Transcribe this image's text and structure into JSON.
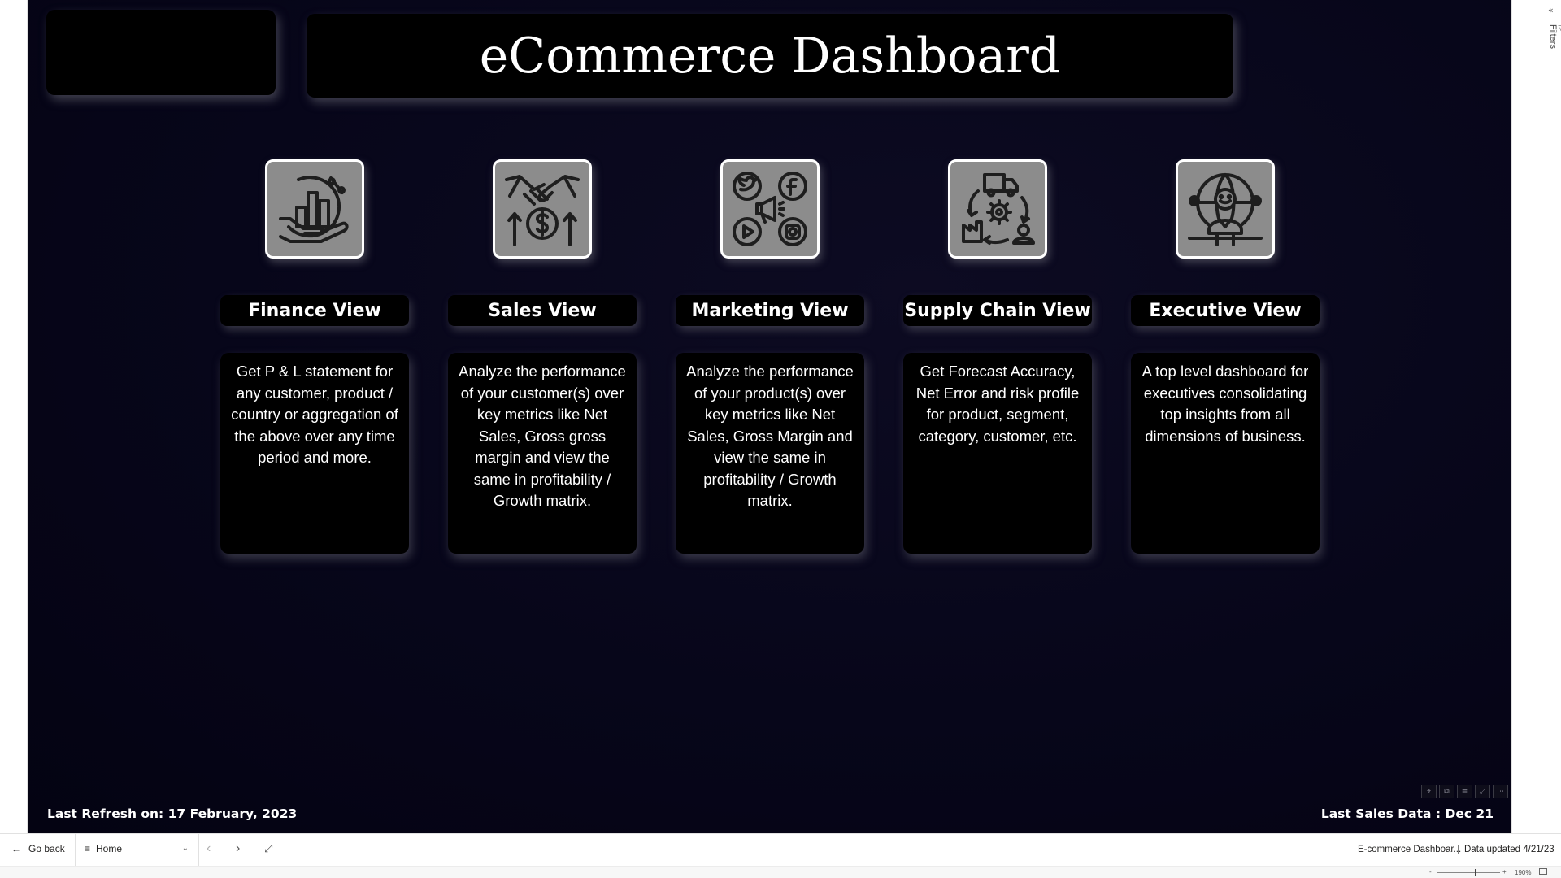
{
  "report": {
    "title": "eCommerce Dashboard",
    "last_refresh": "Last Refresh on: 17 February, 2023",
    "last_sales": "Last Sales Data : Dec 21"
  },
  "views": [
    {
      "label": "Finance View",
      "icon": "finance-hand-chart-icon",
      "description": "Get  P & L statement for any customer, product / country or aggregation of the above over any time period and more."
    },
    {
      "label": "Sales View",
      "icon": "handshake-dollar-icon",
      "description": "Analyze the performance of your customer(s) over key metrics like Net Sales, Gross gross margin and view the same in profitability / Growth matrix."
    },
    {
      "label": "Marketing View",
      "icon": "social-media-megaphone-icon",
      "description": "Analyze the performance of your product(s) over key metrics like Net Sales, Gross Margin and view the same in profitability / Growth matrix."
    },
    {
      "label": "Supply Chain View",
      "icon": "supply-chain-cycle-icon",
      "description": "Get Forecast Accuracy, Net Error and risk profile for product, segment, category, customer, etc."
    },
    {
      "label": "Executive View",
      "icon": "executive-globe-person-icon",
      "description": "A top level dashboard for executives consolidating top insights from all dimensions of business."
    }
  ],
  "filters_pane": {
    "label": "Filters"
  },
  "nav": {
    "go_back": "Go back",
    "page": "Home",
    "report_name": "E-commerce Dashboar...",
    "data_updated": "Data updated 4/21/23"
  },
  "zoom": {
    "level": "190%",
    "minus": "-",
    "plus": "+"
  }
}
